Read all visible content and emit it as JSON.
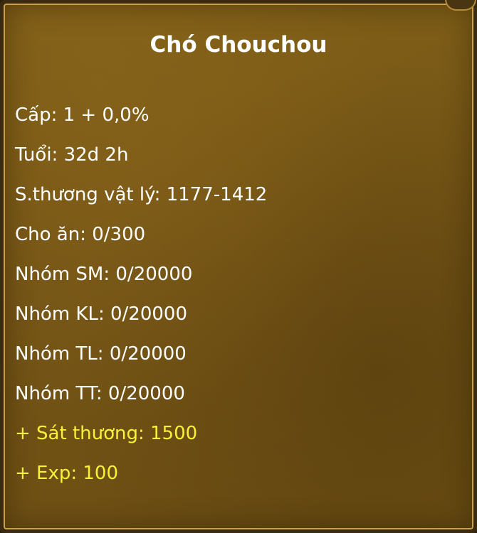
{
  "pet": {
    "title": "Chó Chouchou",
    "stats": [
      {
        "text": "Cấp: 1 + 0,0%"
      },
      {
        "text": "Tuổi: 32d 2h"
      },
      {
        "text": "S.thương vật lý: 1177-1412"
      },
      {
        "text": "Cho ăn: 0/300"
      },
      {
        "text": "Nhóm SM: 0/20000"
      },
      {
        "text": "Nhóm KL: 0/20000"
      },
      {
        "text": "Nhóm TL: 0/20000"
      },
      {
        "text": "Nhóm TT: 0/20000"
      }
    ],
    "bonuses": [
      {
        "text": "+ Sát thương: 1500"
      },
      {
        "text": "+ Exp: 100"
      }
    ]
  },
  "colors": {
    "panel_bg": "#735416",
    "border": "#c9a04e",
    "text": "#ffffff",
    "bonus_text": "#f6f23a"
  }
}
